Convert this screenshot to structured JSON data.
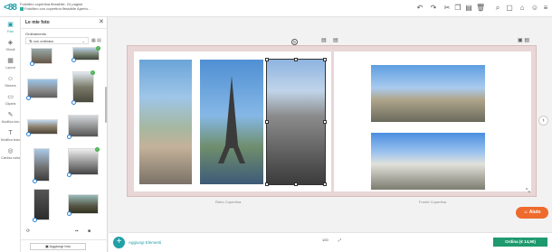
{
  "app": {
    "logo": "<88",
    "project_line1": "Fotolibro copertina flessibile, 24 pagine",
    "project_line2": "Fotolibro con copertina flessibile Apertu..."
  },
  "rail": [
    {
      "label": "Foto",
      "icon": "photo-icon",
      "active": true
    },
    {
      "label": "Sfondi",
      "icon": "background-icon"
    },
    {
      "label": "Layout",
      "icon": "layout-icon"
    },
    {
      "label": "Stickers",
      "icon": "sticker-icon"
    },
    {
      "label": "Cliparts",
      "icon": "clipart-icon"
    },
    {
      "label": "Modifica foto",
      "icon": "edit-photo-icon"
    },
    {
      "label": "Modifica testo",
      "icon": "edit-text-icon"
    },
    {
      "label": "Cambia carta",
      "icon": "paper-icon"
    }
  ],
  "panel": {
    "title": "Le mie foto",
    "sort_label": "Ordinamento",
    "sort_value": "non ordinata",
    "add_photo": "Aggiungi foto"
  },
  "pages": {
    "left_caption": "Retro Copertina",
    "right_caption": "Fronte Copertina"
  },
  "help_label": "Aiuto",
  "bottom": {
    "add_elements": "Aggiungi Elementi",
    "zoom": "100",
    "order_label": "Ordina (€ 14,90)"
  },
  "colors": {
    "accent": "#21a0a8",
    "order": "#1e9a6e",
    "help": "#ee6a2d"
  }
}
